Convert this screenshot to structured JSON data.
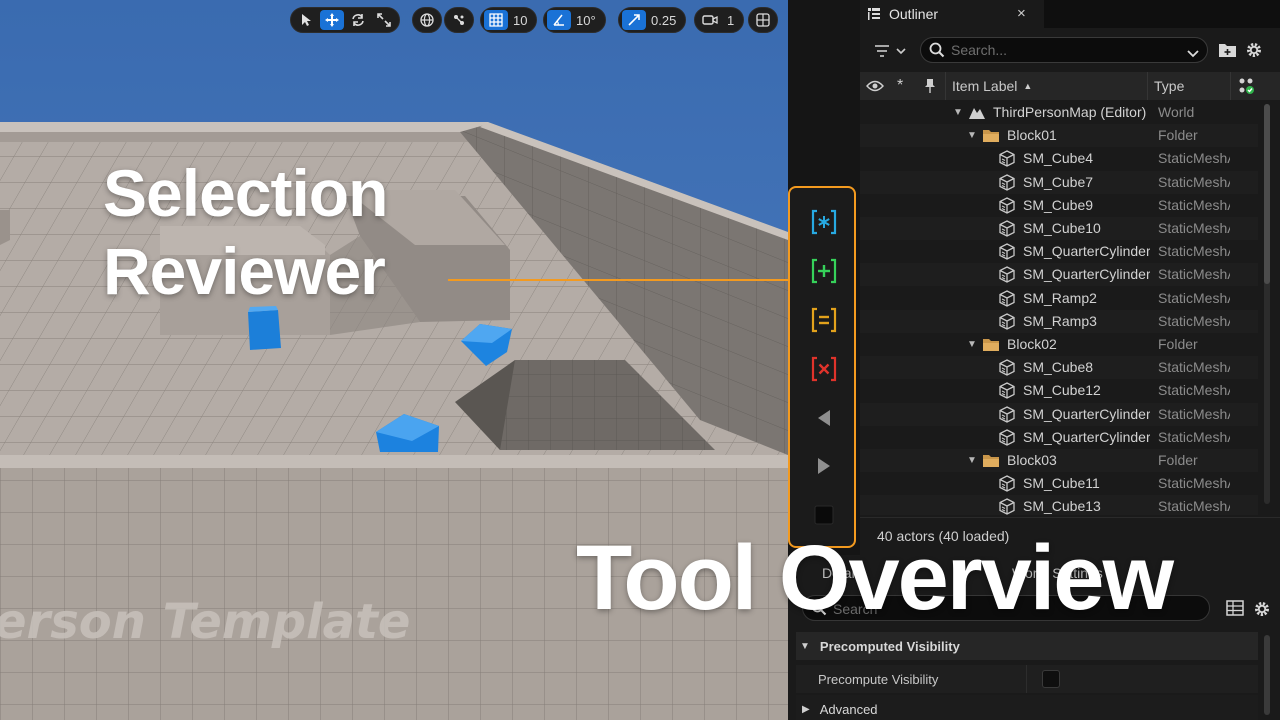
{
  "viewport": {
    "toolbar": {
      "grid_snap_value": "10",
      "rotation_snap_value": "10°",
      "scale_snap_value": "0.25",
      "camera_speed_value": "1"
    },
    "floor_text": "erson Template"
  },
  "headlines": {
    "title": "Selection Reviewer",
    "subtitle": "Tool Overview"
  },
  "reviewer_toolbar": {
    "accent": "#f39a1f",
    "buttons": [
      {
        "name": "select-all",
        "icon": "bracket-asterisk-icon",
        "color": "#27a9e1"
      },
      {
        "name": "add-selection",
        "icon": "bracket-plus-icon",
        "color": "#36d15a"
      },
      {
        "name": "equal-selection",
        "icon": "bracket-equal-icon",
        "color": "#e3a21c"
      },
      {
        "name": "remove-selection",
        "icon": "bracket-x-icon",
        "color": "#e0332b"
      },
      {
        "name": "previous",
        "icon": "triangle-left-icon",
        "color": "#8f8f8f"
      },
      {
        "name": "next",
        "icon": "triangle-right-icon",
        "color": "#8f8f8f"
      },
      {
        "name": "stop",
        "icon": "square-icon",
        "color": "#0a0a0a"
      }
    ]
  },
  "outliner": {
    "tab_title": "Outliner",
    "search_placeholder": "Search...",
    "columns": {
      "label": "Item Label",
      "type": "Type"
    },
    "items": [
      {
        "label": "ThirdPersonMap (Editor)",
        "type": "World",
        "kind": "world",
        "depth": 0
      },
      {
        "label": "Block01",
        "type": "Folder",
        "kind": "folder",
        "depth": 1
      },
      {
        "label": "SM_Cube4",
        "type": "StaticMeshActor",
        "kind": "mesh",
        "depth": 2
      },
      {
        "label": "SM_Cube7",
        "type": "StaticMeshActor",
        "kind": "mesh",
        "depth": 2
      },
      {
        "label": "SM_Cube9",
        "type": "StaticMeshActor",
        "kind": "mesh",
        "depth": 2
      },
      {
        "label": "SM_Cube10",
        "type": "StaticMeshActor",
        "kind": "mesh",
        "depth": 2
      },
      {
        "label": "SM_QuarterCylinder",
        "type": "StaticMeshActor",
        "kind": "mesh",
        "depth": 2
      },
      {
        "label": "SM_QuarterCylinder",
        "type": "StaticMeshActor",
        "kind": "mesh",
        "depth": 2
      },
      {
        "label": "SM_Ramp2",
        "type": "StaticMeshActor",
        "kind": "mesh",
        "depth": 2
      },
      {
        "label": "SM_Ramp3",
        "type": "StaticMeshActor",
        "kind": "mesh",
        "depth": 2
      },
      {
        "label": "Block02",
        "type": "Folder",
        "kind": "folder",
        "depth": 1
      },
      {
        "label": "SM_Cube8",
        "type": "StaticMeshActor",
        "kind": "mesh",
        "depth": 2
      },
      {
        "label": "SM_Cube12",
        "type": "StaticMeshActor",
        "kind": "mesh",
        "depth": 2
      },
      {
        "label": "SM_QuarterCylinder",
        "type": "StaticMeshActor",
        "kind": "mesh",
        "depth": 2
      },
      {
        "label": "SM_QuarterCylinder",
        "type": "StaticMeshActor",
        "kind": "mesh",
        "depth": 2
      },
      {
        "label": "Block03",
        "type": "Folder",
        "kind": "folder",
        "depth": 1
      },
      {
        "label": "SM_Cube11",
        "type": "StaticMeshActor",
        "kind": "mesh",
        "depth": 2
      },
      {
        "label": "SM_Cube13",
        "type": "StaticMeshActor",
        "kind": "mesh",
        "depth": 2
      }
    ],
    "status": "40 actors (40 loaded)"
  },
  "details": {
    "tabs": [
      "Details",
      "World Settings"
    ],
    "search_placeholder": "Search",
    "sections": [
      {
        "title": "Precomputed Visibility",
        "expanded": true
      },
      {
        "title": "Advanced",
        "expanded": false
      }
    ],
    "property_label": "Precompute Visibility",
    "property_checked": false
  }
}
